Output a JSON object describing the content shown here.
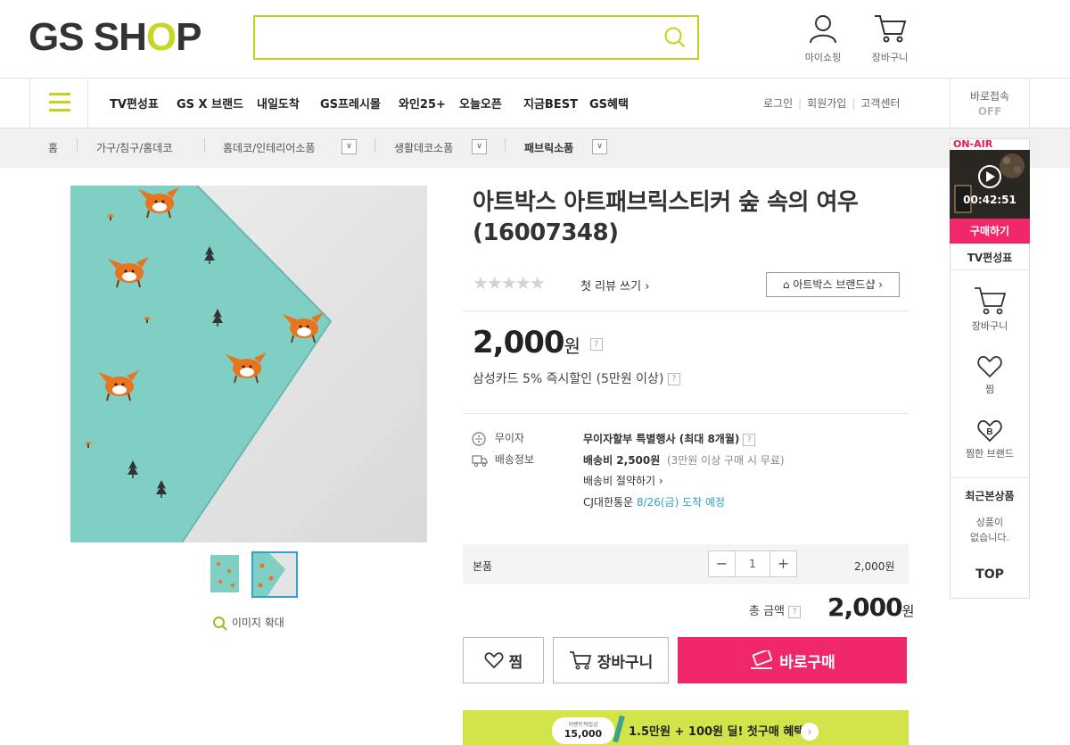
{
  "header": {
    "logo": {
      "pre": "GS SH",
      "o": "O",
      "post": "P"
    },
    "search_placeholder": "",
    "mypage": "마이쇼핑",
    "cart": "장바구니"
  },
  "nav": {
    "items": [
      "TV편성표",
      "GS X 브랜드",
      "내일도착",
      "GS프레시몰",
      "와인25+",
      "오늘오픈",
      "지금BEST",
      "GS혜택"
    ],
    "login": "로그인",
    "signup": "회원가입",
    "support": "고객센터",
    "quick_access": "바로접속",
    "quick_state": "OFF"
  },
  "breadcrumb": {
    "home": "홈",
    "c1": "가구/침구/홈데코",
    "c2": "홈데코/인테리어소품",
    "c3": "생활데코소품",
    "c4": "패브릭소품"
  },
  "product": {
    "title": "아트박스 아트패브릭스티커 숲 속의 여우 (16007348)",
    "stars": "★★★★★",
    "review_link": "첫 리뷰 쓰기",
    "brand_shop": "아트박스 브랜드샵",
    "price": "2,000",
    "won": "원",
    "card_discount": "삼성카드 5% 즉시할인 (5만원 이상)",
    "installment_label": "무이자",
    "installment_value": "무이자할부 특별행사 (최대 8개월)",
    "delivery_label": "배송정보",
    "shipping_fee": "배송비 2,500원",
    "shipping_note": "(3만원 이상 구매 시 무료)",
    "shipping_save": "배송비 절약하기",
    "courier": "CJ대한통운",
    "arrival": "8/26(금) 도착 예정",
    "zoom": "이미지 확대"
  },
  "option": {
    "name": "본품",
    "qty": "1",
    "price": "2,000원"
  },
  "total": {
    "label": "총 금액",
    "amount": "2,000",
    "won": "원"
  },
  "buttons": {
    "wish": "찜",
    "cart": "장바구니",
    "buy": "바로구매"
  },
  "promo": {
    "badge_small": "이벤트적립금",
    "badge_amount": "15,000",
    "text": "1.5만원 + 100원 딜! 첫구매 혜택"
  },
  "side": {
    "on_air": "ON-AIR",
    "timer": "00:42:51",
    "buy_now": "구매하기",
    "tv_schedule": "TV편성표",
    "cart": "장바구니",
    "wish": "찜",
    "wish_brand": "찜한 브랜드",
    "recent_title": "최근본상품",
    "recent_empty_1": "상품이",
    "recent_empty_2": "없습니다.",
    "top": "TOP"
  },
  "colors": {
    "brand_lime": "#c4d21d",
    "buy_pink": "#f0286a",
    "link_teal": "#2da1c5",
    "promo_bg": "#d3e34a"
  }
}
